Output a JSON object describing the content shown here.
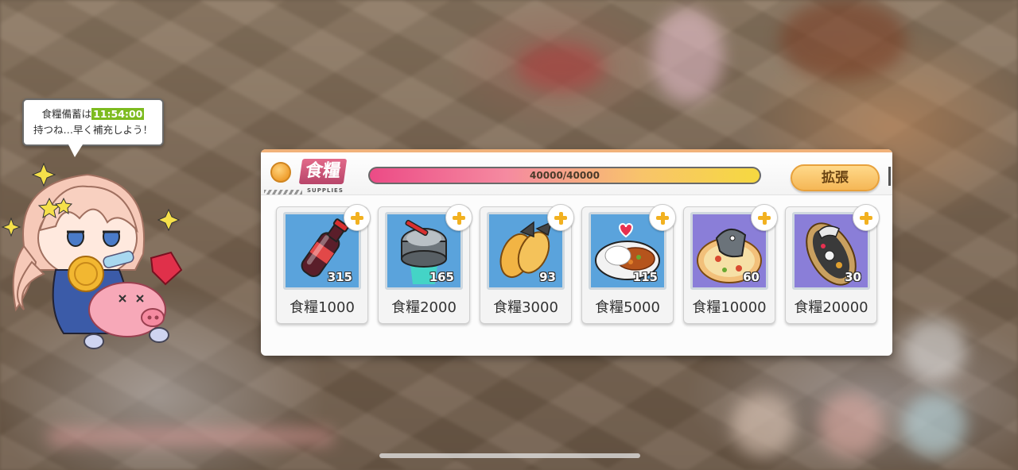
{
  "speech_bubble": {
    "line1_prefix": "食糧備蓄は",
    "line1_time": "11:54:00",
    "line2": "持つね…早く補充しよう！"
  },
  "panel": {
    "title": "食糧",
    "subtitle": "SUPPLIES",
    "progress_text": "40000/40000",
    "progress_fraction": 1.0,
    "expand_label": "拡張",
    "accent_color": "#f1b27a"
  },
  "items": [
    {
      "label": "食糧1000",
      "count": "315",
      "art": "soda-bottle-icon",
      "bg": "#5aa3dc"
    },
    {
      "label": "食糧2000",
      "count": "165",
      "art": "canned-ration-icon",
      "bg": "#5aa3dc"
    },
    {
      "label": "食糧3000",
      "count": "93",
      "art": "fried-shrimp-icon",
      "bg": "#5aa3dc"
    },
    {
      "label": "食糧5000",
      "count": "115",
      "art": "curry-plate-icon",
      "bg": "#5aa3dc"
    },
    {
      "label": "食糧10000",
      "count": "60",
      "art": "fish-pizza-icon",
      "bg": "#8a7ed8"
    },
    {
      "label": "食糧20000",
      "count": "30",
      "art": "boat-platter-icon",
      "bg": "#8a7ed8"
    }
  ]
}
